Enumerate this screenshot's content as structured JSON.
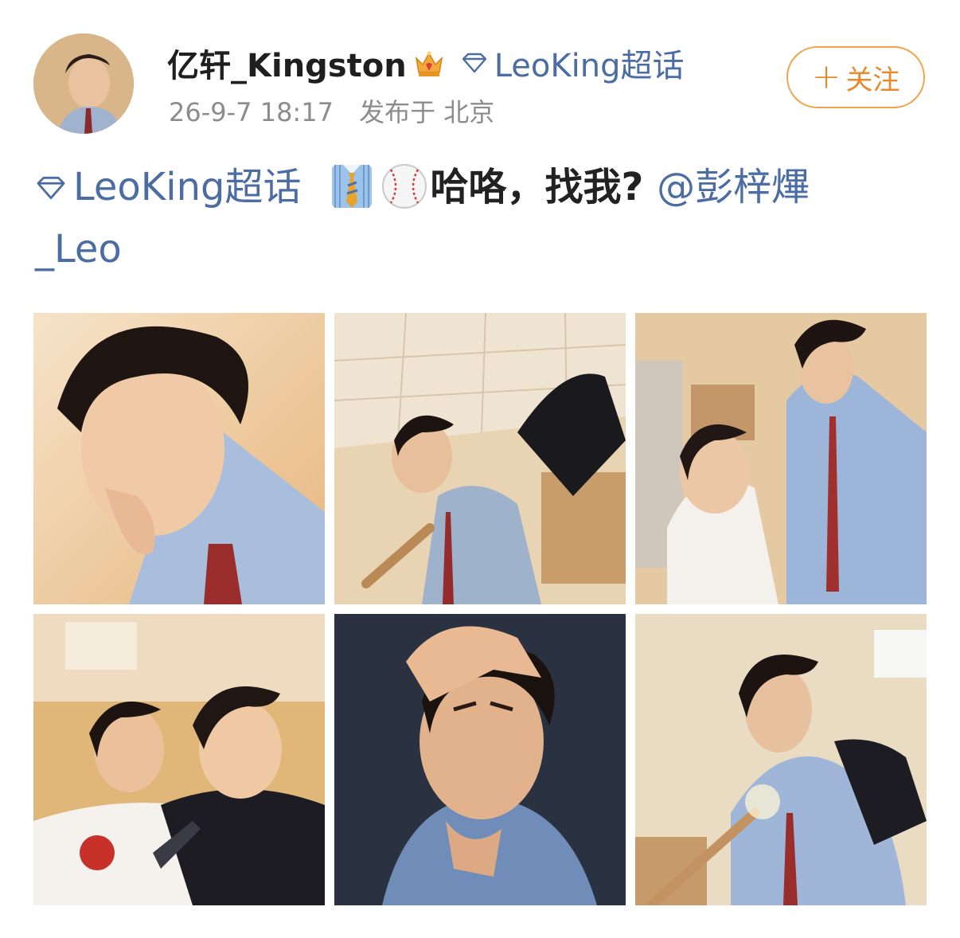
{
  "post": {
    "username": "亿轩_Kingston",
    "badge_topic": "LeoKing超话",
    "time": "26-9-7 18:17",
    "location": "发布于 北京",
    "follow_label": "关注",
    "follow_plus": "+",
    "text": {
      "topic": "LeoKing超话",
      "emojis": [
        "necktie-emoji",
        "baseball-emoji"
      ],
      "message": "哈咯，找我?",
      "mention_line1": "@彭梓熚",
      "mention_line2": "_Leo"
    }
  },
  "photos": [
    {
      "name": "photo-1",
      "description_icon": "portrait-photo"
    },
    {
      "name": "photo-2",
      "description_icon": "portrait-photo"
    },
    {
      "name": "photo-3",
      "description_icon": "portrait-photo"
    },
    {
      "name": "photo-4",
      "description_icon": "portrait-photo"
    },
    {
      "name": "photo-5",
      "description_icon": "portrait-photo"
    },
    {
      "name": "photo-6",
      "description_icon": "portrait-photo"
    }
  ],
  "colors": {
    "link_blue": "#4b6da3",
    "follow_orange": "#e88a2a",
    "meta_gray": "#8c8c8c"
  }
}
